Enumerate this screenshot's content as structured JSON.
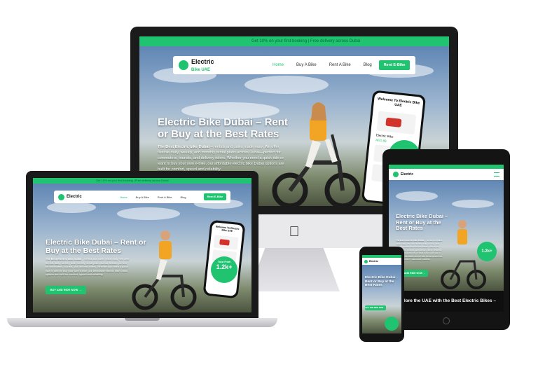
{
  "brand": {
    "name": "Electric",
    "sub": "Bike UAE",
    "accent": "#1fc370"
  },
  "topbar_text": "Get 10% on your first booking | Free delivery across Dubai",
  "nav": {
    "items": [
      "Home",
      "Buy A Bike",
      "Rent A Bike",
      "Blog"
    ],
    "cta": "Rent E-Bike"
  },
  "hero": {
    "title": "Electric Bike Dubai – Rent or Buy at the Best Rates",
    "lead_bold": "The Best Electric bike Dubai",
    "body": " – rentals and sales made easy. We offer flexible daily, weekly, and monthly rental plans across Dubai—perfect for commuters, tourists, and delivery riders. Whether you need a quick ride or want to buy your own e-bike, our affordable electric bike Dubai options are built for comfort, speed and reliability.",
    "button": "BUY AND RIDE NOW →"
  },
  "app": {
    "welcome": "Welcome To Electric Bike UAE",
    "trust_label": "Trust From",
    "trust_value": "1.2k",
    "trust_suffix": "+",
    "product_label": "Electric Bike",
    "price": "AED 89"
  },
  "tablet_footer": "Explore the UAE with the Best Electric Bikes –",
  "mobile_button": "BUY AND RIDE NOW →",
  "device_icon": "apple-logo-icon"
}
